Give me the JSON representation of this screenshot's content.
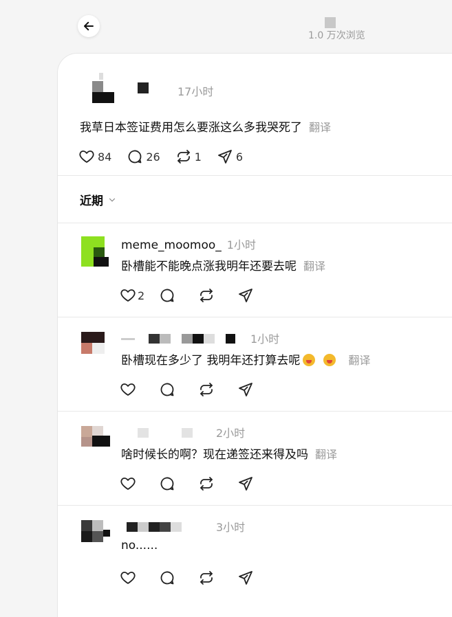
{
  "header": {
    "views": "1.0 万次浏览"
  },
  "post": {
    "time": "17小时",
    "text": "我草日本签证费用怎么要涨这么多我哭死了",
    "translate": "翻译",
    "likes": "84",
    "replies": "26",
    "reposts": "1",
    "shares": "6"
  },
  "sort": {
    "label": "近期"
  },
  "comments": [
    {
      "username": "meme_moomoo_",
      "time": "1小时",
      "text": "卧槽能不能晚点涨我明年还要去呢",
      "translate": "翻译",
      "likes": "2"
    },
    {
      "username": "",
      "time": "1小时",
      "text": "卧槽现在多少了 我明年还打算去呢",
      "translate": "翻译",
      "likes": ""
    },
    {
      "username": "",
      "time": "2小时",
      "text": "啥时候长的啊？现在递签还来得及吗",
      "translate": "翻译",
      "likes": ""
    },
    {
      "username": "",
      "time": "3小时",
      "text": "no......",
      "translate": "",
      "likes": ""
    }
  ],
  "icons": [
    "back-arrow-icon",
    "heart-icon",
    "reply-icon",
    "repost-icon",
    "share-icon",
    "chevron-down-icon"
  ]
}
